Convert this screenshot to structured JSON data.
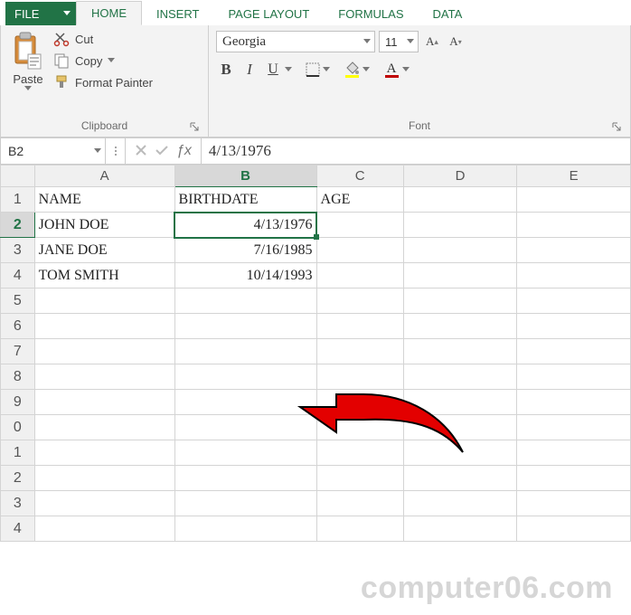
{
  "titlebar": {
    "file_label": "FILE"
  },
  "tabs": {
    "items": [
      {
        "label": "HOME",
        "active": true
      },
      {
        "label": "INSERT",
        "active": false
      },
      {
        "label": "PAGE LAYOUT",
        "active": false
      },
      {
        "label": "FORMULAS",
        "active": false
      },
      {
        "label": "DATA",
        "active": false
      }
    ]
  },
  "ribbon": {
    "clipboard": {
      "title": "Clipboard",
      "paste": "Paste",
      "cut": "Cut",
      "copy": "Copy",
      "format_painter": "Format Painter"
    },
    "font": {
      "title": "Font",
      "name": "Georgia",
      "size": "11",
      "bold": "B",
      "italic": "I",
      "underline": "U"
    }
  },
  "formula_bar": {
    "namebox": "B2",
    "value": "4/13/1976"
  },
  "grid": {
    "columns": [
      "A",
      "B",
      "C",
      "D",
      "E"
    ],
    "rows": [
      {
        "n": "1",
        "A": "NAME",
        "B": "BIRTHDATE",
        "C": "AGE",
        "D": "",
        "E": ""
      },
      {
        "n": "2",
        "A": "JOHN DOE",
        "B": "4/13/1976",
        "C": "",
        "D": "",
        "E": ""
      },
      {
        "n": "3",
        "A": "JANE DOE",
        "B": "7/16/1985",
        "C": "",
        "D": "",
        "E": ""
      },
      {
        "n": "4",
        "A": "TOM SMITH",
        "B": "10/14/1993",
        "C": "",
        "D": "",
        "E": ""
      },
      {
        "n": "5",
        "A": "",
        "B": "",
        "C": "",
        "D": "",
        "E": ""
      },
      {
        "n": "6",
        "A": "",
        "B": "",
        "C": "",
        "D": "",
        "E": ""
      },
      {
        "n": "7",
        "A": "",
        "B": "",
        "C": "",
        "D": "",
        "E": ""
      },
      {
        "n": "8",
        "A": "",
        "B": "",
        "C": "",
        "D": "",
        "E": ""
      },
      {
        "n": "9",
        "A": "",
        "B": "",
        "C": "",
        "D": "",
        "E": ""
      },
      {
        "n": "0",
        "A": "",
        "B": "",
        "C": "",
        "D": "",
        "E": ""
      },
      {
        "n": "1b",
        "A": "",
        "B": "",
        "C": "",
        "D": "",
        "E": ""
      },
      {
        "n": "2b",
        "A": "",
        "B": "",
        "C": "",
        "D": "",
        "E": ""
      },
      {
        "n": "3b",
        "A": "",
        "B": "",
        "C": "",
        "D": "",
        "E": ""
      },
      {
        "n": "4b",
        "A": "",
        "B": "",
        "C": "",
        "D": "",
        "E": ""
      }
    ],
    "row_labels": [
      "1",
      "2",
      "3",
      "4",
      "5",
      "6",
      "7",
      "8",
      "9",
      "0",
      "1",
      "2",
      "3",
      "4"
    ],
    "selected": {
      "col": "B",
      "row": 2
    }
  },
  "watermark": "computer06.com"
}
